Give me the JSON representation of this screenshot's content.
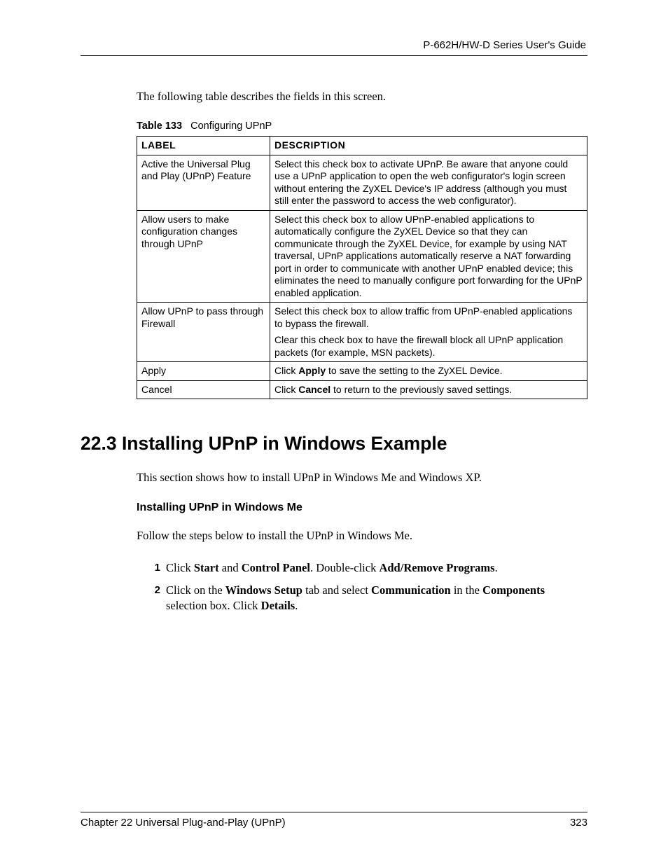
{
  "header": {
    "guide_title": "P-662H/HW-D Series User's Guide"
  },
  "intro": "The following table describes the fields in this screen.",
  "table_caption": {
    "prefix": "Table 133",
    "title": "Configuring UPnP"
  },
  "table": {
    "headers": {
      "label": "LABEL",
      "description": "DESCRIPTION"
    },
    "rows": [
      {
        "label": "Active the Universal Plug and Play (UPnP) Feature",
        "desc": [
          "Select this check box to activate UPnP. Be aware that anyone could use a UPnP application to open the web configurator's login screen without entering the ZyXEL Device's IP address (although you must still enter the password to access the web configurator)."
        ]
      },
      {
        "label": "Allow users to make configuration changes through UPnP",
        "desc": [
          "Select this check box to allow UPnP-enabled applications to automatically configure the ZyXEL Device so that they can communicate through the ZyXEL Device, for example by using NAT traversal, UPnP applications automatically reserve a NAT forwarding port in order to communicate with another UPnP enabled device; this eliminates the need to manually configure port forwarding for the UPnP enabled application."
        ]
      },
      {
        "label": "Allow UPnP to pass through Firewall",
        "desc": [
          "Select this check box to allow traffic from UPnP-enabled applications to bypass the firewall.",
          "Clear this check box to have the firewall block all UPnP application packets (for example, MSN packets)."
        ]
      },
      {
        "label": "Apply",
        "desc_pre": "Click ",
        "desc_bold": "Apply",
        "desc_post": " to save the setting to the ZyXEL Device."
      },
      {
        "label": "Cancel",
        "desc_pre": "Click ",
        "desc_bold": "Cancel",
        "desc_post": " to return to the previously saved settings."
      }
    ]
  },
  "section": {
    "heading": "22.3  Installing UPnP in Windows Example",
    "intro": "This section shows how to install UPnP in Windows Me and Windows XP.",
    "sub_heading": "Installing UPnP in Windows Me",
    "sub_intro": "Follow the steps below to install the UPnP in Windows Me.",
    "steps": [
      {
        "num": "1",
        "parts": [
          {
            "t": "Click "
          },
          {
            "b": "Start"
          },
          {
            "t": " and "
          },
          {
            "b": "Control Panel"
          },
          {
            "t": ". Double-click "
          },
          {
            "b": "Add/Remove Programs"
          },
          {
            "t": "."
          }
        ]
      },
      {
        "num": "2",
        "parts": [
          {
            "t": "Click on the "
          },
          {
            "b": "Windows Setup"
          },
          {
            "t": " tab and select "
          },
          {
            "b": "Communication"
          },
          {
            "t": " in the "
          },
          {
            "b": "Components"
          },
          {
            "t": " selection box. Click "
          },
          {
            "b": "Details"
          },
          {
            "t": "."
          }
        ]
      }
    ]
  },
  "footer": {
    "chapter": "Chapter 22 Universal Plug-and-Play (UPnP)",
    "page": "323"
  }
}
